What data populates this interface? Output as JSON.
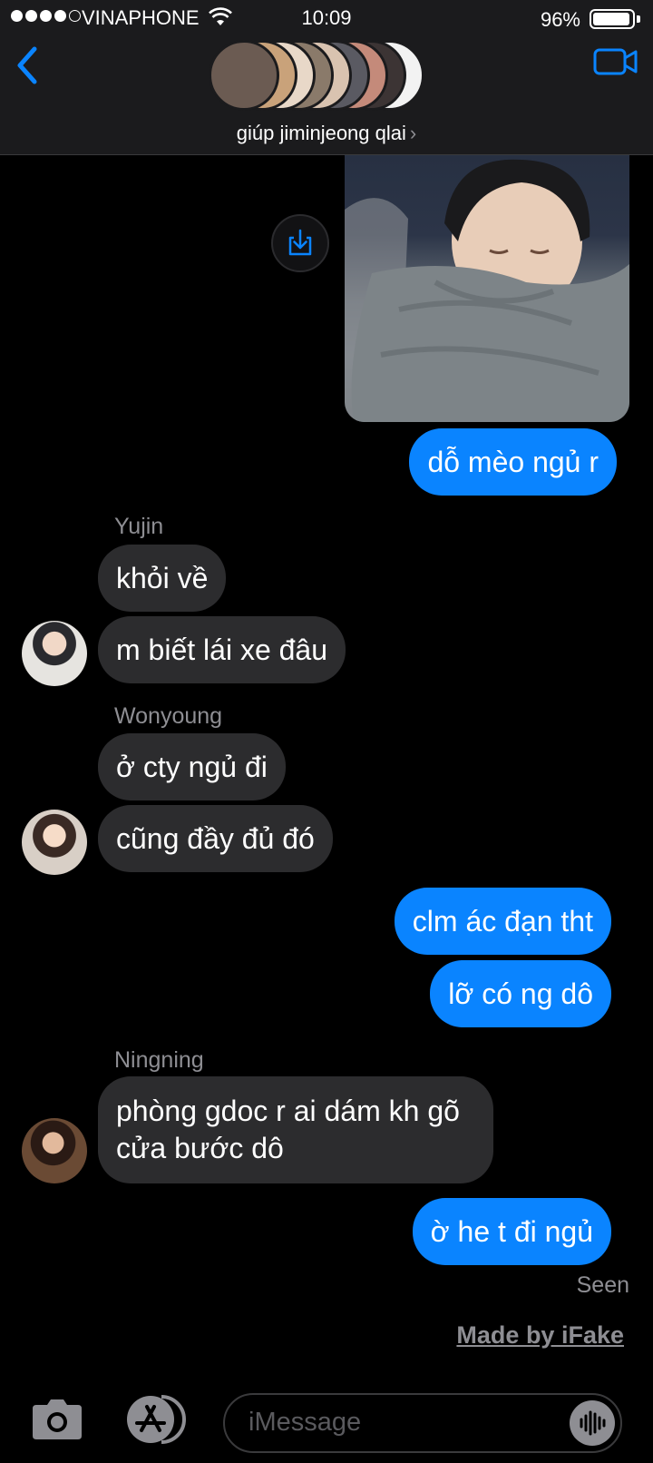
{
  "status": {
    "carrier": "VINAPHONE",
    "time": "10:09",
    "battery": "96%",
    "battery_level": 0.96
  },
  "header": {
    "group_name": "giúp jiminjeong qlai",
    "chevron": "›",
    "icons": [
      "back-chevron-icon",
      "video-camera-icon"
    ]
  },
  "messages": [
    {
      "type": "image",
      "direction": "out",
      "icon": "share-download-icon"
    },
    {
      "text": "dỗ mèo ngủ r",
      "direction": "out"
    },
    {
      "sender": "Yujin"
    },
    {
      "text": "khỏi về",
      "direction": "in"
    },
    {
      "text": "m biết lái xe đâu",
      "direction": "in"
    },
    {
      "sender": "Wonyoung"
    },
    {
      "text": "ở cty ngủ đi",
      "direction": "in"
    },
    {
      "text": "cũng đầy đủ đó",
      "direction": "in"
    },
    {
      "text": "clm ác đạn tht",
      "direction": "out"
    },
    {
      "text": "lỡ có ng dô",
      "direction": "out"
    },
    {
      "sender": "Ningning"
    },
    {
      "text": "phòng gdoc r ai dám kh gõ cửa bước dô",
      "direction": "in"
    },
    {
      "text": "ờ he t đi ngủ",
      "direction": "out"
    }
  ],
  "seen": "Seen",
  "watermark": "Made by iFake",
  "input": {
    "placeholder": "iMessage",
    "icons": [
      "camera-icon",
      "app-store-icon",
      "audio-waveform-icon"
    ]
  },
  "colors": {
    "outgoing": "#0a84ff",
    "incoming": "#2c2c2e",
    "background": "#000000",
    "header": "#1b1b1d"
  }
}
